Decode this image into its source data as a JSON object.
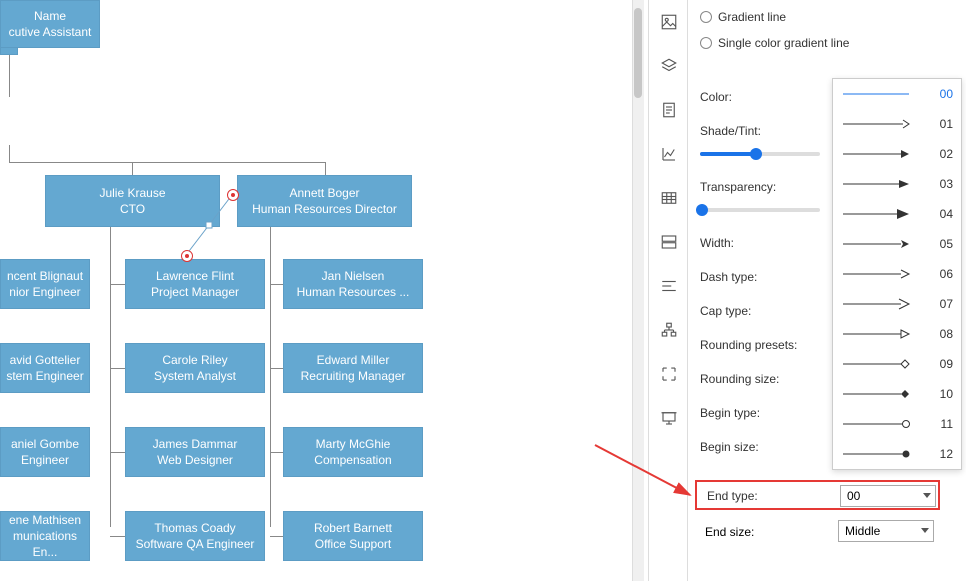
{
  "radios": {
    "gradient": "Gradient line",
    "single": "Single color gradient line"
  },
  "props": {
    "color": "Color:",
    "shade": "Shade/Tint:",
    "transparency": "Transparency:",
    "width": "Width:",
    "dash": "Dash type:",
    "cap": "Cap type:",
    "rounding_presets": "Rounding presets:",
    "rounding_size": "Rounding size:",
    "begin_type": "Begin type:",
    "begin_size": "Begin size:",
    "end_type": "End type:",
    "end_size": "End size:"
  },
  "end_type_value": "00",
  "end_size_value": "Middle",
  "end_type_options": [
    "00",
    "01",
    "02",
    "03",
    "04",
    "05",
    "06",
    "07",
    "08",
    "09",
    "10",
    "11",
    "12"
  ],
  "org": {
    "root_partial": {
      "name": "Name",
      "title": "cutive Assistant"
    },
    "level2": [
      {
        "name": "Julie Krause",
        "title": "CTO"
      },
      {
        "name": "Annett Boger",
        "title": "Human Resources Director"
      }
    ],
    "level3": [
      {
        "name": "ncent Blignaut",
        "title": "nior Engineer"
      },
      {
        "name": "Lawrence Flint",
        "title": "Project Manager"
      },
      {
        "name": "Jan Nielsen",
        "title": "Human Resources ..."
      }
    ],
    "level4": [
      {
        "name": "avid Gottelier",
        "title": "stem Engineer"
      },
      {
        "name": "Carole Riley",
        "title": "System Analyst"
      },
      {
        "name": "Edward Miller",
        "title": "Recruiting Manager"
      }
    ],
    "level5": [
      {
        "name": "aniel Gombe",
        "title": "Engineer"
      },
      {
        "name": "James Dammar",
        "title": "Web Designer"
      },
      {
        "name": "Marty McGhie",
        "title": "Compensation"
      }
    ],
    "level6": [
      {
        "name": "ene Mathisen",
        "title": "munications En..."
      },
      {
        "name": "Thomas Coady",
        "title": "Software QA Engineer"
      },
      {
        "name": "Robert Barnett",
        "title": "Office Support"
      }
    ]
  }
}
